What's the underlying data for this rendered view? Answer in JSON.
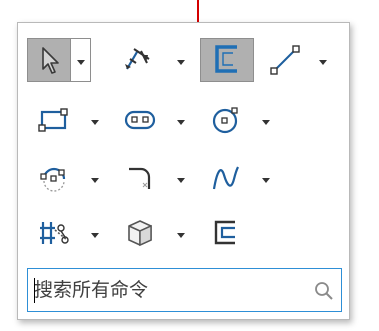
{
  "colors": {
    "icon_blue": "#1f5f9e",
    "selected_bg": "#b0b0b0",
    "search_border": "#2e8fd6",
    "cursor_marker": "#d40000"
  },
  "tools": [
    {
      "icon": "select-arrow-icon",
      "selected": true,
      "has_dropdown": true
    },
    {
      "icon": "smart-dimension-icon",
      "selected": false,
      "has_dropdown": true
    },
    {
      "icon": "exit-sketch-icon",
      "selected": true,
      "has_dropdown": false
    },
    {
      "icon": "line-icon",
      "selected": false,
      "has_dropdown": true
    },
    {
      "icon": "rectangle-icon",
      "selected": false,
      "has_dropdown": true
    },
    {
      "icon": "slot-icon",
      "selected": false,
      "has_dropdown": true
    },
    {
      "icon": "circle-icon",
      "selected": false,
      "has_dropdown": true
    },
    {
      "icon": "arc-icon",
      "selected": false,
      "has_dropdown": true
    },
    {
      "icon": "fillet-icon",
      "selected": false,
      "has_dropdown": true
    },
    {
      "icon": "spline-icon",
      "selected": false,
      "has_dropdown": true
    },
    {
      "icon": "trim-icon",
      "selected": false,
      "has_dropdown": true
    },
    {
      "icon": "3d-box-icon",
      "selected": false,
      "has_dropdown": true
    },
    {
      "icon": "offset-entities-icon",
      "selected": false,
      "has_dropdown": false
    }
  ],
  "search": {
    "placeholder": "搜索所有命令",
    "value": "",
    "icon": "search-icon"
  }
}
